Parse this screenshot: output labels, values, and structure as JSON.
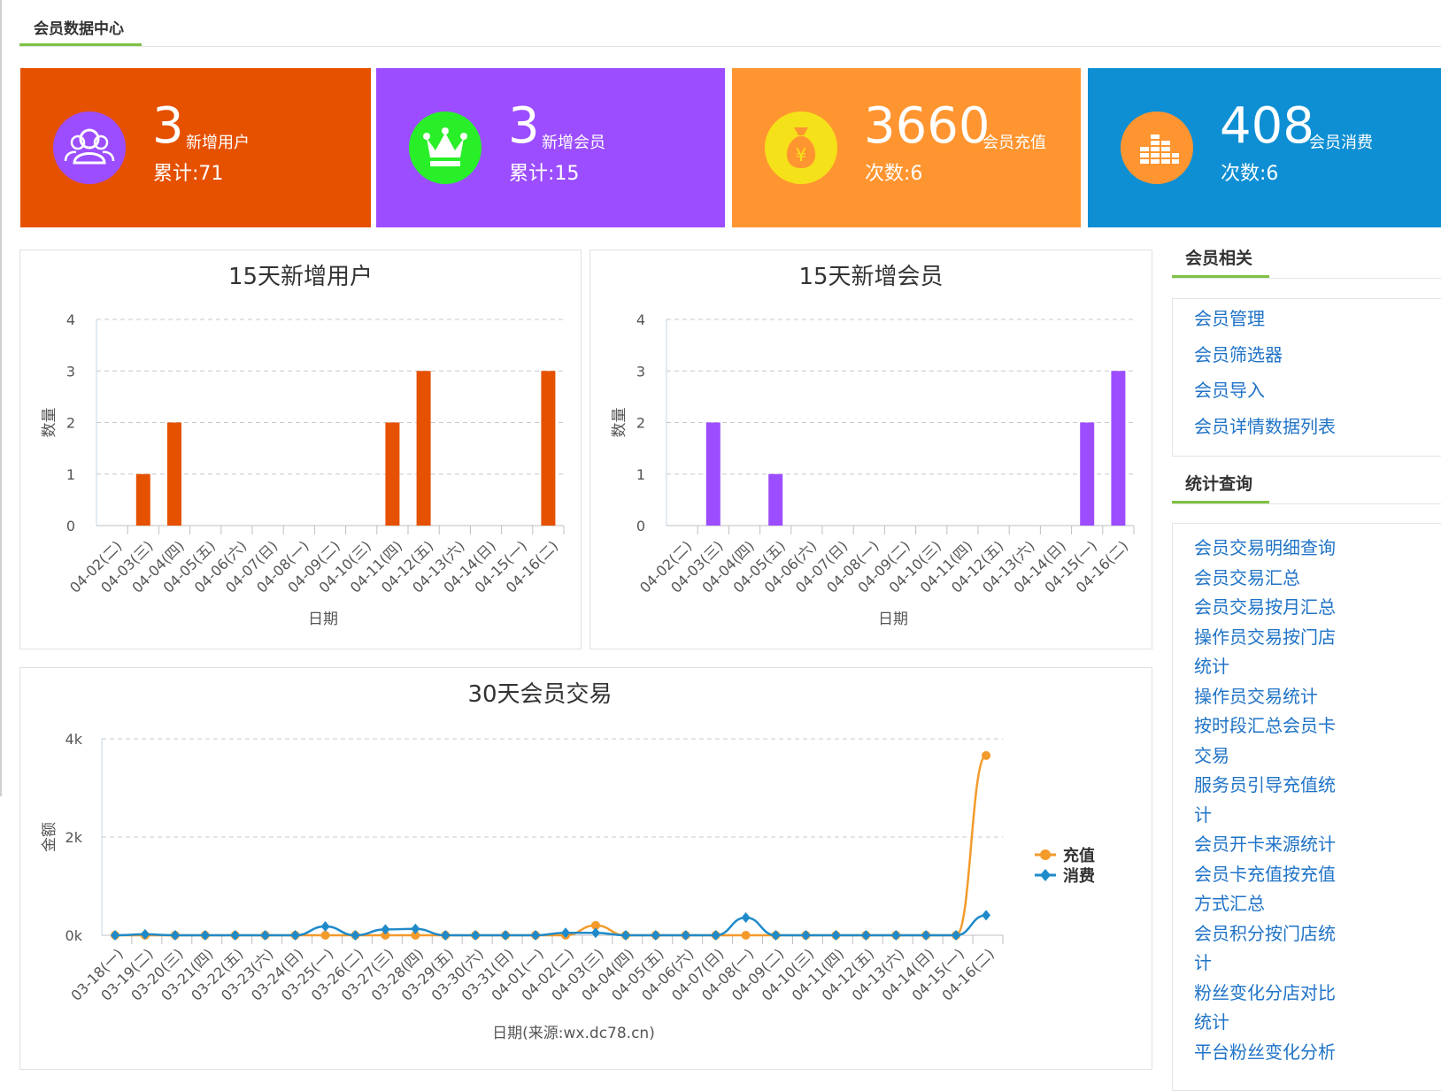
{
  "page_title": "会员数据中心",
  "cards": [
    {
      "value": "3",
      "label": "新增用户",
      "sub": "累计:71",
      "bg": "#e65100",
      "badge_color": "#9c4dff",
      "icon": "users-icon"
    },
    {
      "value": "3",
      "label": "新增会员",
      "sub": "累计:15",
      "bg": "#9c4dff",
      "badge_color": "#29ef29",
      "icon": "crown-icon"
    },
    {
      "value": "3660",
      "label": "会员充值",
      "sub": "次数:6",
      "bg": "#ff9530",
      "badge_color": "#f5e11a",
      "icon": "money-bag-icon"
    },
    {
      "value": "408",
      "label": "会员消费",
      "sub": "次数:6",
      "bg": "#0e8fd4",
      "badge_color": "#ff9530",
      "icon": "bar-stack-icon"
    }
  ],
  "chart_data": [
    {
      "type": "bar",
      "title": "15天新增用户",
      "xlabel": "日期",
      "ylabel": "数量",
      "ylim": [
        0,
        4
      ],
      "yticks": [
        "0",
        "1",
        "2",
        "3",
        "4"
      ],
      "grid": true,
      "color": "#e65100",
      "categories": [
        "04-02(二)",
        "04-03(三)",
        "04-04(四)",
        "04-05(五)",
        "04-06(六)",
        "04-07(日)",
        "04-08(一)",
        "04-09(二)",
        "04-10(三)",
        "04-11(四)",
        "04-12(五)",
        "04-13(六)",
        "04-14(日)",
        "04-15(一)",
        "04-16(二)"
      ],
      "values": [
        0,
        1,
        2,
        0,
        0,
        0,
        0,
        0,
        0,
        2,
        3,
        0,
        0,
        0,
        3
      ]
    },
    {
      "type": "bar",
      "title": "15天新增会员",
      "xlabel": "日期",
      "ylabel": "数量",
      "ylim": [
        0,
        4
      ],
      "yticks": [
        "0",
        "1",
        "2",
        "3",
        "4"
      ],
      "grid": true,
      "color": "#9c4dff",
      "categories": [
        "04-02(二)",
        "04-03(三)",
        "04-04(四)",
        "04-05(五)",
        "04-06(六)",
        "04-07(日)",
        "04-08(一)",
        "04-09(二)",
        "04-10(三)",
        "04-11(四)",
        "04-12(五)",
        "04-13(六)",
        "04-14(日)",
        "04-15(一)",
        "04-16(二)"
      ],
      "values": [
        0,
        2,
        0,
        1,
        0,
        0,
        0,
        0,
        0,
        0,
        0,
        0,
        0,
        2,
        3
      ]
    },
    {
      "type": "line",
      "title": "30天会员交易",
      "xlabel": "日期(来源:wx.dc78.cn)",
      "ylabel": "金额",
      "ylim": [
        0,
        4000
      ],
      "yticks": [
        "0k",
        "2k",
        "4k"
      ],
      "grid": true,
      "legend": "right",
      "categories": [
        "03-18(一)",
        "03-19(二)",
        "03-20(三)",
        "03-21(四)",
        "03-22(五)",
        "03-23(六)",
        "03-24(日)",
        "03-25(一)",
        "03-26(二)",
        "03-27(三)",
        "03-28(四)",
        "03-29(五)",
        "03-30(六)",
        "03-31(日)",
        "04-01(一)",
        "04-02(二)",
        "04-03(三)",
        "04-04(四)",
        "04-05(五)",
        "04-06(六)",
        "04-07(日)",
        "04-08(一)",
        "04-09(二)",
        "04-10(三)",
        "04-11(四)",
        "04-12(五)",
        "04-13(六)",
        "04-14(日)",
        "04-15(一)",
        "04-16(二)"
      ],
      "series": [
        {
          "name": "充值",
          "color": "#f39a2b",
          "marker": "circle",
          "values": [
            0,
            0,
            0,
            0,
            0,
            0,
            0,
            0,
            0,
            0,
            0,
            0,
            0,
            0,
            0,
            0,
            200,
            0,
            0,
            0,
            0,
            0,
            0,
            0,
            0,
            0,
            0,
            0,
            0,
            3660
          ]
        },
        {
          "name": "消费",
          "color": "#1f8ac9",
          "marker": "diamond",
          "values": [
            0,
            20,
            0,
            0,
            0,
            0,
            0,
            180,
            0,
            120,
            130,
            0,
            0,
            0,
            0,
            50,
            50,
            0,
            0,
            0,
            0,
            360,
            0,
            0,
            0,
            0,
            0,
            0,
            0,
            408
          ]
        }
      ]
    }
  ],
  "sidebar": {
    "sections": [
      {
        "title": "会员相关",
        "items": [
          "会员管理",
          "会员筛选器",
          "会员导入",
          "会员详情数据列表"
        ]
      },
      {
        "title": "统计查询",
        "items": [
          "会员交易明细查询",
          "会员交易汇总",
          "会员交易按月汇总",
          "操作员交易按门店",
          " 统计",
          "操作员交易统计",
          "按时段汇总会员卡",
          " 交易",
          "服务员引导充值统",
          " 计",
          "会员开卡来源统计",
          "会员卡充值按充值",
          " 方式汇总",
          "会员积分按门店统",
          " 计",
          "粉丝变化分店对比",
          " 统计",
          "平台粉丝变化分析"
        ]
      }
    ]
  }
}
